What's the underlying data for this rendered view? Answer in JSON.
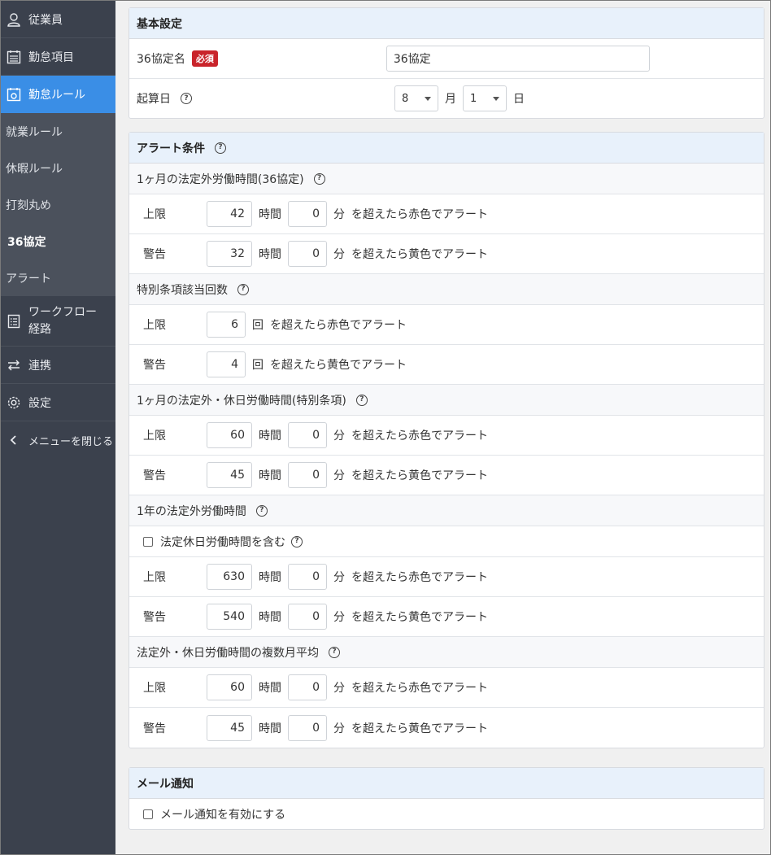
{
  "sidebar": {
    "items": [
      {
        "label": "従業員",
        "icon": "user-icon"
      },
      {
        "label": "勤怠項目",
        "icon": "calendar-list-icon"
      },
      {
        "label": "勤怠ルール",
        "icon": "calendar-gear-icon"
      }
    ],
    "sub_items": [
      "就業ルール",
      "休暇ルール",
      "打刻丸め",
      "36協定",
      "アラート"
    ],
    "workflow": {
      "line1": "ワークフロー",
      "line2": "経路"
    },
    "link": "連携",
    "settings": "設定",
    "close": "メニューを閉じる"
  },
  "basic": {
    "title": "基本設定",
    "name_label": "36協定名",
    "required": "必須",
    "name_value": "36協定",
    "start_label": "起算日",
    "month_value": "8",
    "month_unit": "月",
    "day_value": "1",
    "day_unit": "日"
  },
  "units": {
    "hour": "時間",
    "min": "分",
    "times": "回",
    "upper": "上限",
    "warn": "警告",
    "red": "を超えたら赤色でアラート",
    "yellow": "を超えたら黄色でアラート"
  },
  "alert": {
    "title": "アラート条件",
    "s1": {
      "title": "1ヶ月の法定外労働時間(36協定)",
      "upper_h": "42",
      "upper_m": "0",
      "warn_h": "32",
      "warn_m": "0"
    },
    "s2": {
      "title": "特別条項該当回数",
      "upper": "6",
      "warn": "4"
    },
    "s3": {
      "title": "1ヶ月の法定外・休日労働時間(特別条項)",
      "upper_h": "60",
      "upper_m": "0",
      "warn_h": "45",
      "warn_m": "0"
    },
    "s4": {
      "title": "1年の法定外労働時間",
      "checkbox": "法定休日労働時間を含む",
      "upper_h": "630",
      "upper_m": "0",
      "warn_h": "540",
      "warn_m": "0"
    },
    "s5": {
      "title": "法定外・休日労働時間の複数月平均",
      "upper_h": "60",
      "upper_m": "0",
      "warn_h": "45",
      "warn_m": "0"
    }
  },
  "mail": {
    "title": "メール通知",
    "checkbox": "メール通知を有効にする"
  }
}
